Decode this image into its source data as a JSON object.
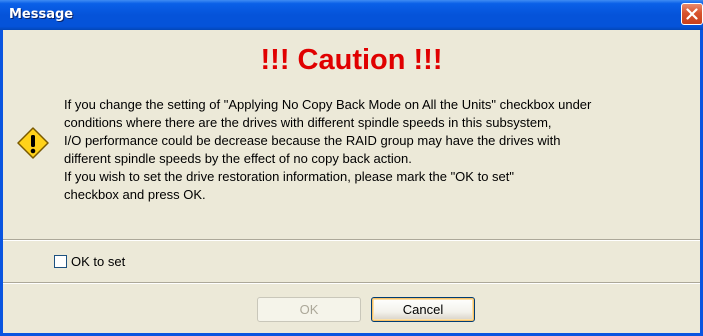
{
  "window": {
    "title": "Message"
  },
  "heading": "!!! Caution !!!",
  "icons": {
    "warning": "warning-icon",
    "close": "close-icon"
  },
  "message_lines": [
    "If you change the setting of \"Applying No Copy Back Mode on All the Units\" checkbox under",
    "conditions where there are the drives with different spindle speeds in this subsystem,",
    "I/O performance could be decrease because the RAID group may have the drives with",
    "different spindle speeds by the effect of no copy back action.",
    "If you wish to set the drive restoration information, please mark the \"OK to set\"",
    "checkbox and press OK."
  ],
  "checkbox": {
    "label": "OK to set",
    "checked": false
  },
  "buttons": {
    "ok": "OK",
    "ok_enabled": false,
    "cancel": "Cancel"
  },
  "colors": {
    "heading": "#e00000",
    "titlebar": "#0553d9",
    "background": "#ece9d8"
  }
}
